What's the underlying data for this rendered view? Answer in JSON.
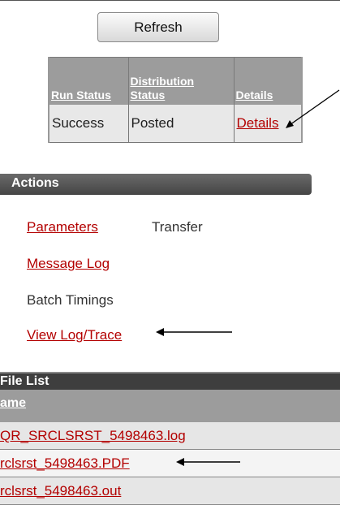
{
  "toolbar": {
    "refresh_label": "Refresh"
  },
  "status_table": {
    "headers": {
      "run_status": "Run Status",
      "distribution_status": "Distribution Status",
      "details": "Details"
    },
    "row": {
      "run_status": "Success",
      "distribution_status": "Posted",
      "details": "Details"
    }
  },
  "actions": {
    "title": "Actions",
    "parameters": "Parameters",
    "transfer": "Transfer",
    "message_log": "Message Log",
    "batch_timings": "Batch Timings",
    "view_log_trace": "View Log/Trace"
  },
  "file_list": {
    "title": "File List",
    "name_header": "ame",
    "files": [
      "QR_SRCLSRST_5498463.log",
      "rclsrst_5498463.PDF",
      "rclsrst_5498463.out"
    ]
  },
  "colors": {
    "link": "#b30000",
    "header_gray": "#9c9c9c",
    "bar_dark": "#454545"
  }
}
